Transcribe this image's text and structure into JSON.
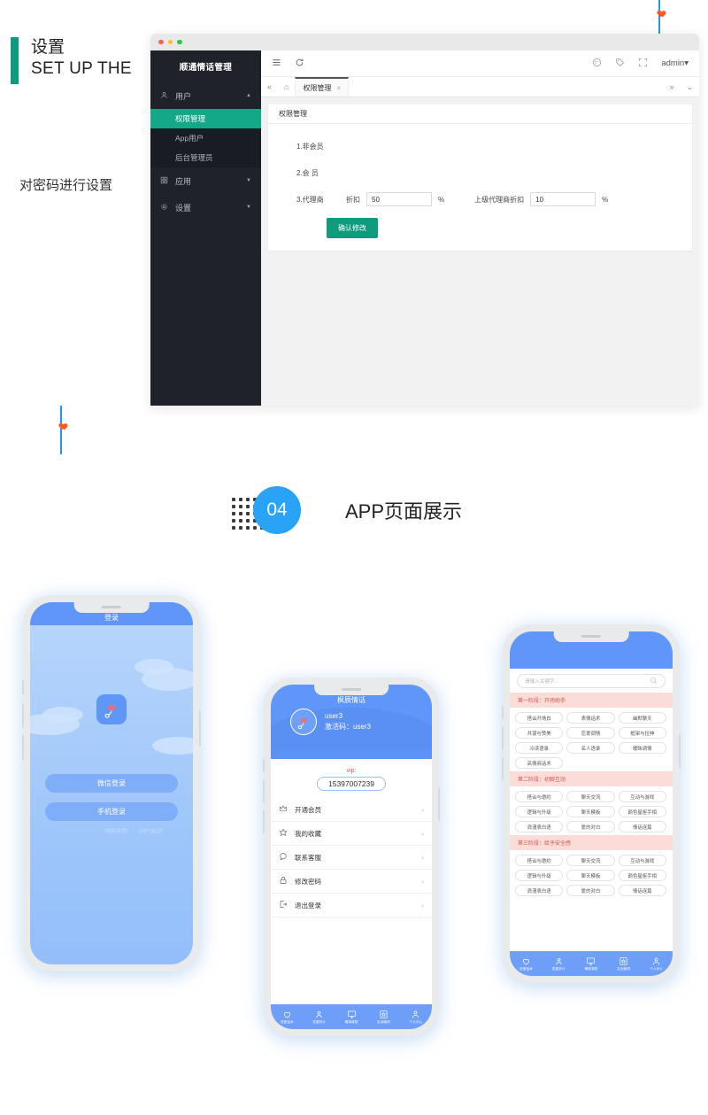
{
  "section": {
    "heading_cn": "设置",
    "heading_en": "SET UP THE",
    "note": "对密码进行设置",
    "accent_color": "#0d9b7f"
  },
  "admin_window": {
    "sidebar": {
      "logo": "顺通情话管理",
      "groups": [
        {
          "icon": "user-icon",
          "label": "用户",
          "expanded": true,
          "caret": "▲",
          "items": [
            {
              "label": "权限管理",
              "active": true
            },
            {
              "label": "App用户",
              "active": false
            },
            {
              "label": "后台管理员",
              "active": false
            }
          ]
        },
        {
          "icon": "app-icon",
          "label": "应用",
          "expanded": false,
          "caret": "▼",
          "items": []
        },
        {
          "icon": "gear-icon",
          "label": "设置",
          "expanded": false,
          "caret": "▼",
          "items": []
        }
      ]
    },
    "topbar": {
      "menu_icon": "hamburger-icon",
      "refresh_icon": "refresh-icon",
      "theme_icon": "theme-icon",
      "tag_icon": "tag-icon",
      "fullscreen_icon": "fullscreen-icon",
      "user_label": "admin",
      "user_caret": "▾"
    },
    "tabbar": {
      "collapse_icon": "«",
      "home_icon": "⌂",
      "tabs": [
        {
          "label": "权限管理",
          "close": "×",
          "active": true
        }
      ],
      "more_icon": "»",
      "down_icon": "⌄"
    },
    "card": {
      "title": "权限管理",
      "rows": [
        {
          "label": "1.非会员",
          "fields": []
        },
        {
          "label": "2.会 员",
          "fields": []
        },
        {
          "label": "3.代理商",
          "fields": [
            {
              "name": "折扣",
              "value": "50",
              "unit": "%"
            },
            {
              "name": "上级代理商折扣",
              "value": "10",
              "unit": "%"
            }
          ]
        }
      ],
      "submit_label": "确认修改",
      "submit_color": "#0f9b7e"
    }
  },
  "step": {
    "number": "04",
    "title": "APP页面展示",
    "badge_color": "#29a3f5"
  },
  "phone_login": {
    "header_title": "登录",
    "logo_icon": "heart-hand-icon",
    "buttons": [
      "微信登录",
      "手机登录"
    ],
    "terms_prefix": "登录即代表您已同意",
    "terms_link1": "《隐私政策》",
    "terms_mid": "和",
    "terms_link2": "《用户协议》"
  },
  "phone_profile": {
    "header_title": "枫辰情话",
    "avatar_icon": "heart-hand-icon",
    "user_name": "user3",
    "activation_label": "激活码：user3",
    "vip_label": "vip:",
    "vip_number": "15397007239",
    "rows": [
      {
        "icon": "crown-icon",
        "label": "开通会员",
        "arrow": "›"
      },
      {
        "icon": "star-icon",
        "label": "我的收藏",
        "arrow": "›"
      },
      {
        "icon": "headset-icon",
        "label": "联系客服",
        "arrow": "›"
      },
      {
        "icon": "lock-icon",
        "label": "修改密码",
        "arrow": "›"
      },
      {
        "icon": "logout-icon",
        "label": "退出登录",
        "arrow": "›"
      }
    ],
    "tabs": [
      {
        "icon": "heart-icon",
        "label": "恋爱话术"
      },
      {
        "icon": "person-icon",
        "label": "恋爱妙计"
      },
      {
        "icon": "board-icon",
        "label": "情商课堂"
      },
      {
        "icon": "case-icon",
        "label": "实战案例"
      },
      {
        "icon": "user-icon",
        "label": "个人中心"
      }
    ]
  },
  "phone_list": {
    "search_placeholder": "请输入关键字...",
    "search_icon": "search-icon",
    "sections": [
      {
        "title": "第一阶段：开场助手",
        "tags": [
          "搭讪开场白",
          "表情话术",
          "幽默聊天",
          "共谋与赞美",
          "恋爱调情",
          "框架与拉伸",
          "冷读语录",
          "名人语录",
          "暧昧调情",
          "高情商话术"
        ]
      },
      {
        "title": "第二阶段：初聊互动",
        "tags": [
          "搭讪与邀约",
          "聊天交流",
          "互动与游戏",
          "逻辑与升级",
          "聊天模板",
          "颜色星座手相",
          "浪漫表白语",
          "爱的对白",
          "情话连篇"
        ]
      },
      {
        "title": "第三阶段：给予安全感",
        "tags": [
          "搭讪与邀约",
          "聊天交流",
          "互动与游戏",
          "逻辑与升级",
          "聊天模板",
          "颜色星座手相",
          "浪漫表白语",
          "爱的对白",
          "情话连篇"
        ]
      }
    ],
    "tabs": [
      {
        "icon": "heart-icon",
        "label": "恋爱话术"
      },
      {
        "icon": "person-icon",
        "label": "恋爱妙计"
      },
      {
        "icon": "board-icon",
        "label": "情商课堂"
      },
      {
        "icon": "case-icon",
        "label": "实战案例"
      },
      {
        "icon": "user-icon",
        "label": "个人中心"
      }
    ]
  }
}
